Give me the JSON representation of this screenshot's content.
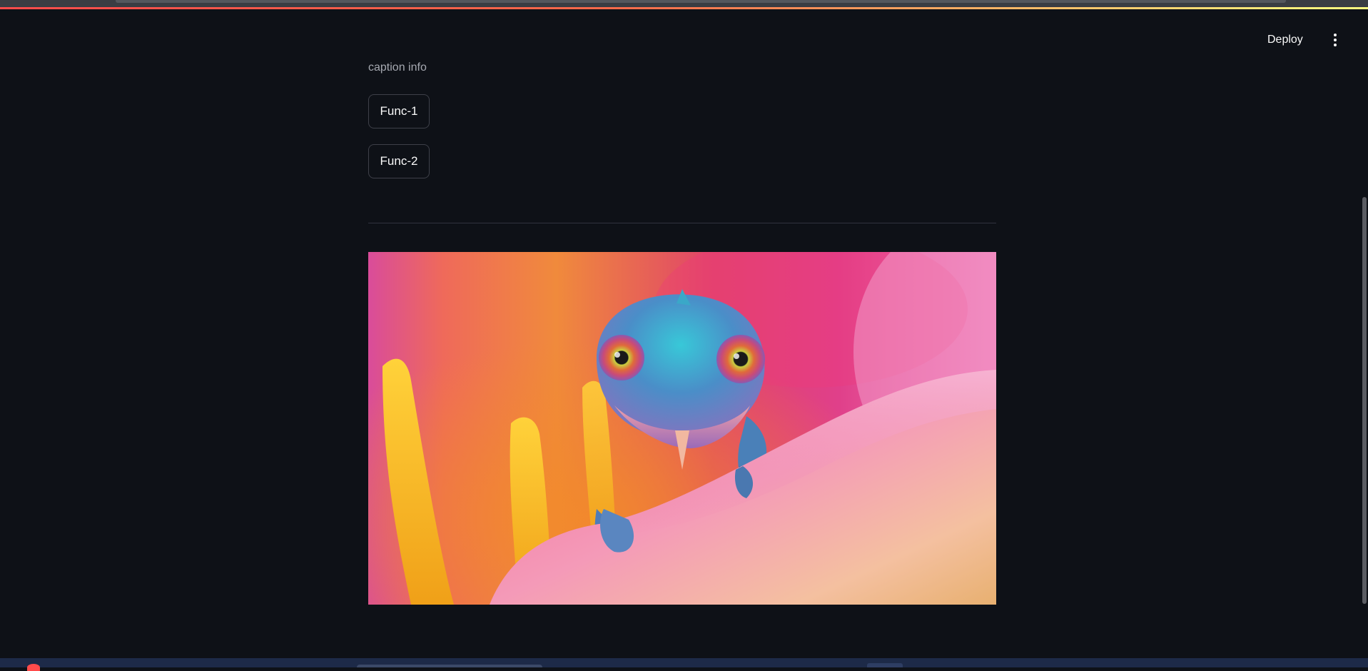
{
  "header": {
    "deploy_label": "Deploy",
    "menu_icon": "vertical-ellipsis-icon"
  },
  "main": {
    "caption": "caption info",
    "buttons": [
      {
        "label": "Func-1"
      },
      {
        "label": "Func-2"
      }
    ],
    "image": {
      "subject": "chameleon-on-flower-petal"
    }
  },
  "colors": {
    "background": "#0e1117",
    "text": "#fafafa",
    "muted_text": "#a6a9b1",
    "button_border": "#3e4049",
    "divider": "#31333f",
    "decoration_start": "#ff4b4b",
    "decoration_end": "#fffd80"
  }
}
